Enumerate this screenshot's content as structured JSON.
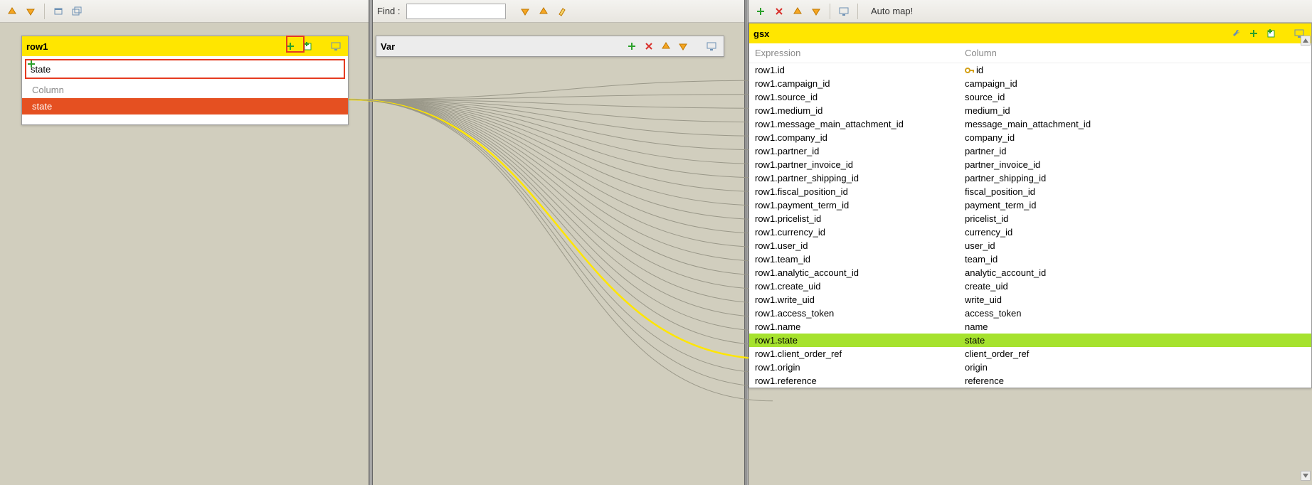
{
  "left": {
    "row_title": "row1",
    "filter_value": "state",
    "column_header": "Column",
    "items": [
      "state"
    ]
  },
  "mid": {
    "find_label": "Find :",
    "find_value": "",
    "var_title": "Var"
  },
  "right": {
    "automap_label": "Auto map!",
    "gsx_title": "gsx",
    "col_expression": "Expression",
    "col_column": "Column",
    "key_column": "id",
    "highlighted": "state",
    "rows": [
      {
        "expr": "row1.id",
        "col": "id",
        "key": true
      },
      {
        "expr": "row1.campaign_id",
        "col": "campaign_id"
      },
      {
        "expr": "row1.source_id",
        "col": "source_id"
      },
      {
        "expr": "row1.medium_id",
        "col": "medium_id"
      },
      {
        "expr": "row1.message_main_attachment_id",
        "col": "message_main_attachment_id"
      },
      {
        "expr": "row1.company_id",
        "col": "company_id"
      },
      {
        "expr": "row1.partner_id",
        "col": "partner_id"
      },
      {
        "expr": "row1.partner_invoice_id",
        "col": "partner_invoice_id"
      },
      {
        "expr": "row1.partner_shipping_id",
        "col": "partner_shipping_id"
      },
      {
        "expr": "row1.fiscal_position_id",
        "col": "fiscal_position_id"
      },
      {
        "expr": "row1.payment_term_id",
        "col": "payment_term_id"
      },
      {
        "expr": "row1.pricelist_id",
        "col": "pricelist_id"
      },
      {
        "expr": "row1.currency_id",
        "col": "currency_id"
      },
      {
        "expr": "row1.user_id",
        "col": "user_id"
      },
      {
        "expr": "row1.team_id",
        "col": "team_id"
      },
      {
        "expr": "row1.analytic_account_id",
        "col": "analytic_account_id"
      },
      {
        "expr": "row1.create_uid",
        "col": "create_uid"
      },
      {
        "expr": "row1.write_uid",
        "col": "write_uid"
      },
      {
        "expr": "row1.access_token",
        "col": "access_token"
      },
      {
        "expr": "row1.name",
        "col": "name"
      },
      {
        "expr": "row1.state",
        "col": "state",
        "hl": true
      },
      {
        "expr": "row1.client_order_ref",
        "col": "client_order_ref"
      },
      {
        "expr": "row1.origin",
        "col": "origin"
      },
      {
        "expr": "row1.reference",
        "col": "reference"
      }
    ]
  },
  "icons": {
    "arrow_up": "arrow-up",
    "arrow_down": "arrow-down",
    "minimize": "minimize",
    "restore": "restore",
    "plus_green": "plus",
    "plus_table": "plus-table",
    "monitor": "monitor",
    "x_red": "x",
    "wrench": "wrench",
    "edit": "edit",
    "find_down": "find-down",
    "find_up": "find-up",
    "highlight": "highlight"
  }
}
